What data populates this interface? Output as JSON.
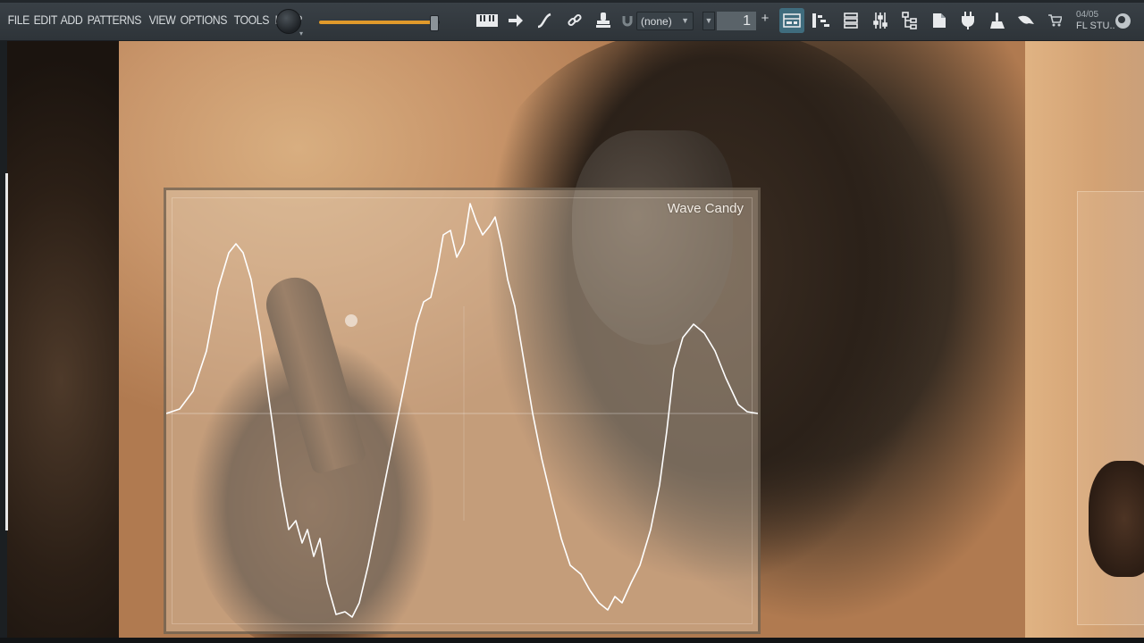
{
  "app": {
    "name": "FL Studio",
    "menu": [
      "FILE",
      "EDIT",
      "ADD",
      "PATTERNS",
      "VIEW",
      "OPTIONS",
      "TOOLS",
      "HELP"
    ]
  },
  "toolbar": {
    "master_volume_level": 0.95,
    "pattern_selector_value": "(none)",
    "pattern_number": "1",
    "plus_label": "+",
    "date_label": "04/05",
    "brand_label": "FL STU..",
    "icons": [
      "piano-typing-icon",
      "arrow-right-icon",
      "curve-icon",
      "link-icon",
      "stamp-icon",
      "magnet-icon",
      "playlist-icon",
      "piano-roll-icon",
      "channel-rack-icon",
      "mixer-icon",
      "browser-icon",
      "project-icon",
      "plugin-icon",
      "touch-icon",
      "feedback-icon",
      "cart-icon",
      "globe-icon"
    ],
    "accent_color": "#e19a2b"
  },
  "wave_candy": {
    "title": "Wave Candy",
    "line_color": "#ffffff"
  }
}
